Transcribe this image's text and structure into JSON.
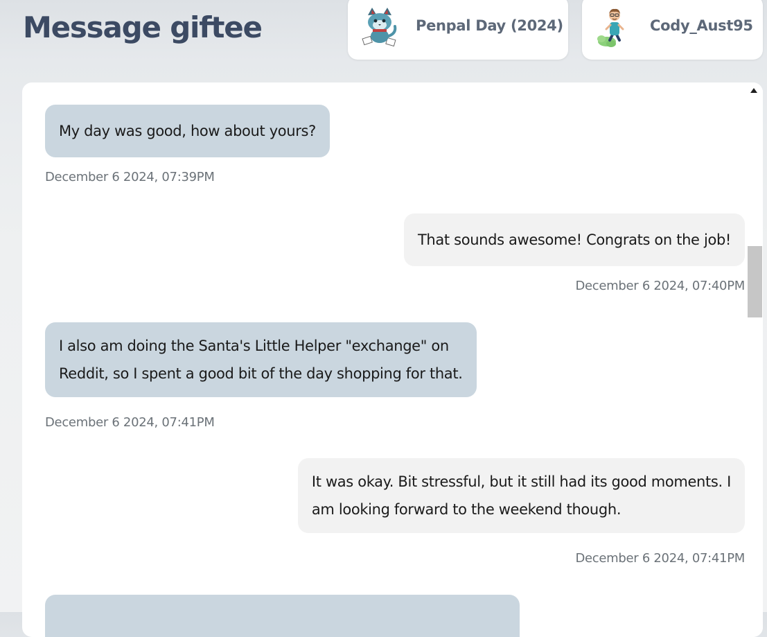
{
  "header": {
    "title": "Message giftee"
  },
  "event_pill": {
    "label": "Penpal Day (2024)",
    "icon": "cat-mascot-icon"
  },
  "user_pill": {
    "label": "Cody_Aust95",
    "icon": "user-avatar-icon"
  },
  "messages": [
    {
      "direction": "incoming",
      "text": "My day was good, how about yours?",
      "timestamp": "December 6 2024, 07:39PM"
    },
    {
      "direction": "outgoing",
      "text": "That sounds awesome! Congrats on the job!",
      "timestamp": "December 6 2024, 07:40PM"
    },
    {
      "direction": "incoming",
      "line1": "I also am doing the Santa's Little Helper \"exchange\" on",
      "line2": "Reddit, so I spent a good bit of the day shopping for that.",
      "timestamp": "December 6 2024, 07:41PM"
    },
    {
      "direction": "outgoing",
      "line1": "It was okay. Bit stressful, but it still had its good moments. I",
      "line2": "am looking forward to the weekend though.",
      "timestamp": "December 6 2024, 07:41PM"
    },
    {
      "direction": "incoming",
      "text": ""
    }
  ],
  "colors": {
    "title": "#3c4a63",
    "incoming_bubble": "#cad6df",
    "outgoing_bubble": "#f2f2f2",
    "timestamp": "#6b7278"
  }
}
